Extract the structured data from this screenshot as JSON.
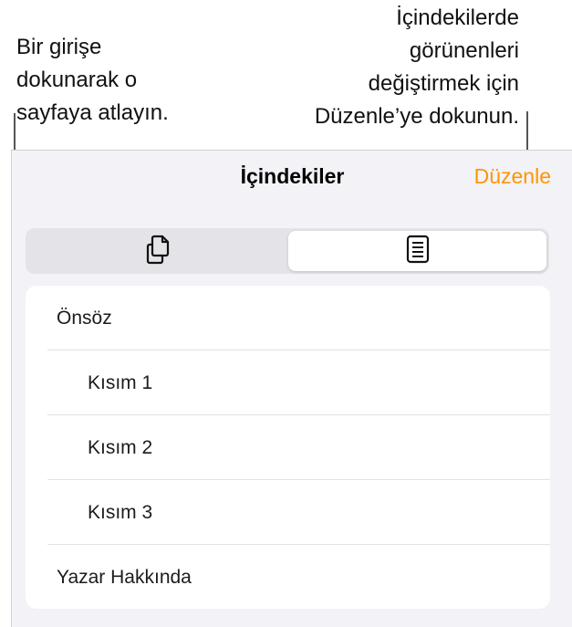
{
  "callouts": {
    "left": "Bir girişe\ndokunarak o\nsayfaya atlayın.",
    "right": "İçindekilerde\ngörünenleri\ndeğiştirmek için\nDüzenle’ye dokunun."
  },
  "nav": {
    "title": "İçindekiler",
    "edit_label": "Düzenle"
  },
  "segments": [
    {
      "icon": "pages-thumbnails-icon",
      "selected": false
    },
    {
      "icon": "table-of-contents-icon",
      "selected": true
    }
  ],
  "toc": {
    "items": [
      {
        "label": "Önsöz",
        "level": 1
      },
      {
        "label": "Kısım 1",
        "level": 2
      },
      {
        "label": "Kısım 2",
        "level": 2
      },
      {
        "label": "Kısım 3",
        "level": 2
      },
      {
        "label": "Yazar Hakkında",
        "level": 1
      }
    ]
  },
  "colors": {
    "accent": "#ff9500",
    "background": "#f2f2f7"
  }
}
